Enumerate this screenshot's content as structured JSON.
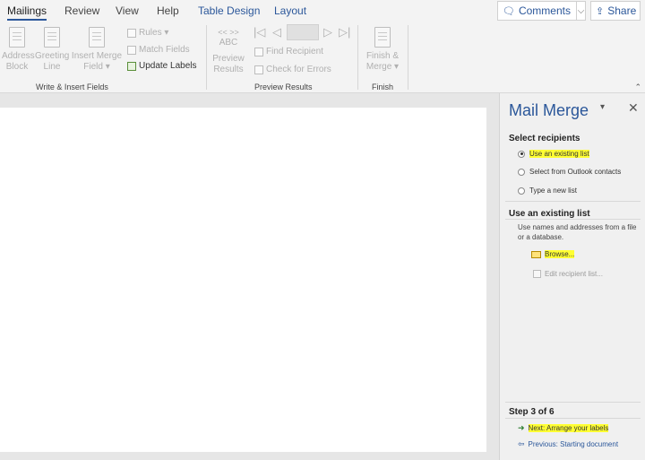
{
  "tabs": [
    "Mailings",
    "Review",
    "View",
    "Help",
    "Table Design",
    "Layout"
  ],
  "topbar": {
    "comments": "Comments",
    "share": "Share"
  },
  "ribbon": {
    "write_insert": {
      "address_block": [
        "Address",
        "Block"
      ],
      "greeting_line": [
        "Greeting",
        "Line"
      ],
      "insert_merge_field": [
        "Insert Merge",
        "Field ▾"
      ],
      "rules": "Rules ▾",
      "match_fields": "Match Fields",
      "update_labels": "Update Labels",
      "group_label": "Write & Insert Fields"
    },
    "preview": {
      "abc_top": "<< >>",
      "abc": "ABC",
      "preview_results": [
        "Preview",
        "Results"
      ],
      "find_recipient": "Find Recipient",
      "check_for_errors": "Check for Errors",
      "group_label": "Preview Results"
    },
    "finish": {
      "finish_merge": [
        "Finish &",
        "Merge ▾"
      ],
      "group_label": "Finish"
    }
  },
  "pane": {
    "title": "Mail Merge",
    "select_recipients": "Select recipients",
    "options": [
      "Use an existing list",
      "Select from Outlook contacts",
      "Type a new list"
    ],
    "selected_index": 0,
    "existing_list_heading": "Use an existing list",
    "existing_list_desc": "Use names and addresses from a file or a database.",
    "browse": "Browse...",
    "edit_list": "Edit recipient list...",
    "step": "Step 3 of 6",
    "next": "Next: Arrange your labels",
    "previous": "Previous: Starting document"
  },
  "colors": {
    "accent": "#2b579a",
    "highlight": "#ffff33",
    "next_arrow": "#2e7d32"
  }
}
